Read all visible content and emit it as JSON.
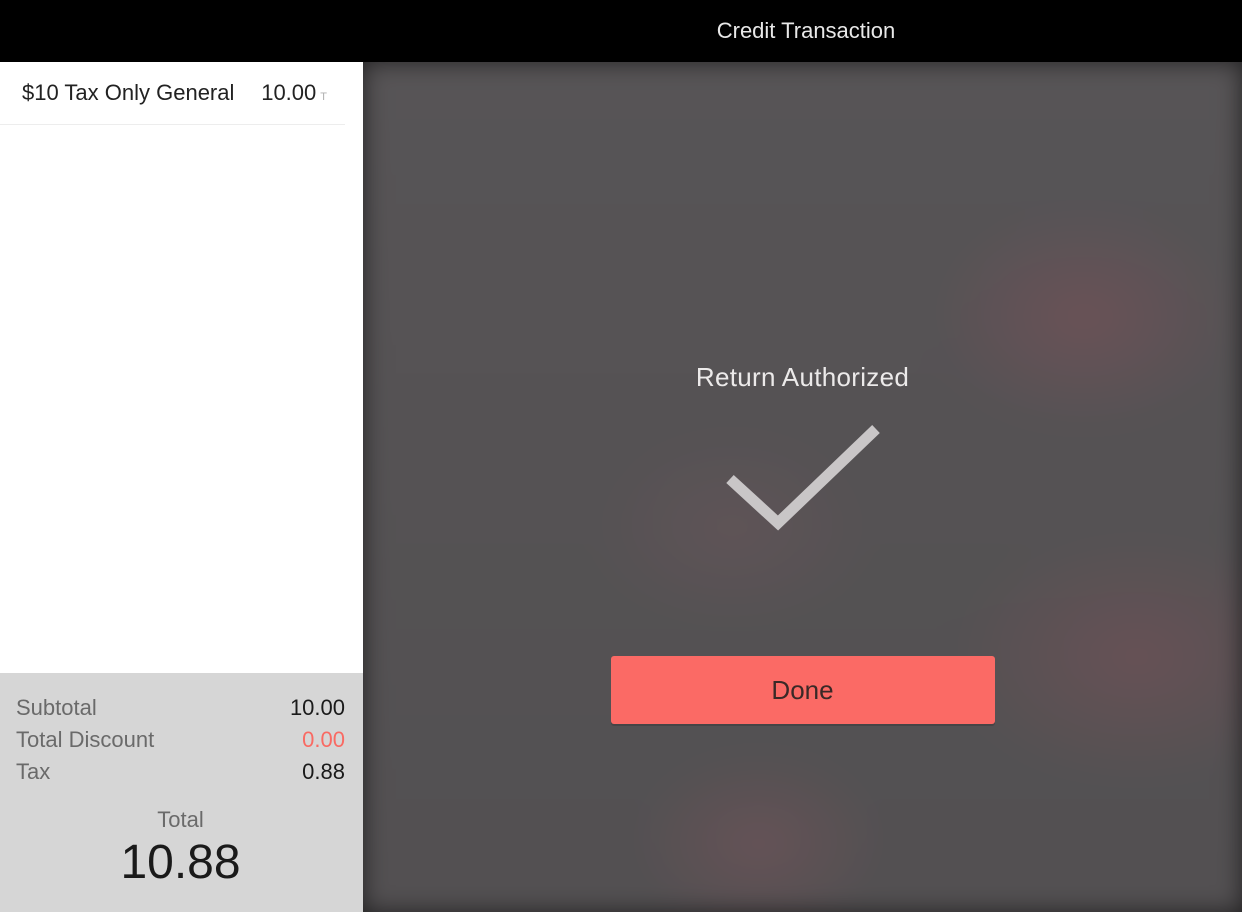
{
  "header": {
    "title": "Credit Transaction"
  },
  "sidebar": {
    "items": [
      {
        "label": "$10 Tax Only General",
        "price": "10.00",
        "suffix": "T"
      }
    ],
    "totals": {
      "subtotal_label": "Subtotal",
      "subtotal_value": "10.00",
      "discount_label": "Total Discount",
      "discount_value": "0.00",
      "tax_label": "Tax",
      "tax_value": "0.88",
      "grand_label": "Total",
      "grand_value": "10.88"
    }
  },
  "main": {
    "status": "Return Authorized",
    "done_label": "Done"
  },
  "colors": {
    "accent": "#fb6a65",
    "discount": "#f96a63"
  }
}
